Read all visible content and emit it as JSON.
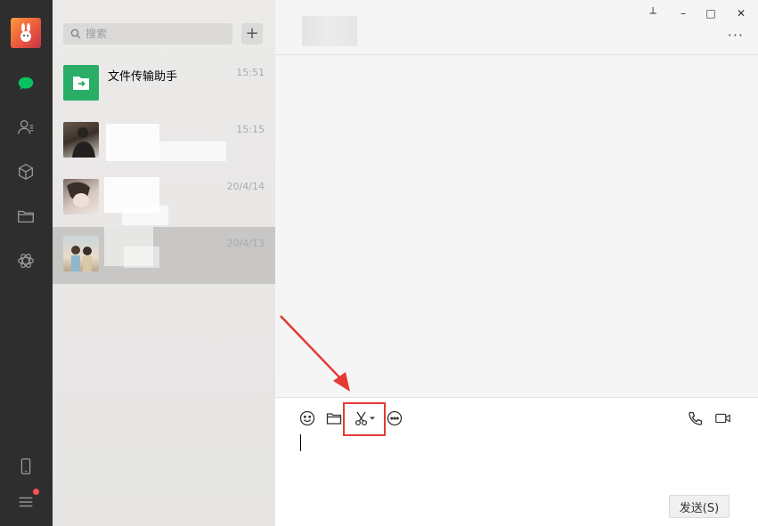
{
  "search": {
    "placeholder": "搜索"
  },
  "list": {
    "add_label": "+",
    "conversations": [
      {
        "name": "文件传输助手",
        "time": "15:51",
        "selected": false
      },
      {
        "name": "",
        "time": "15:15",
        "selected": false
      },
      {
        "name": "",
        "time": "20/4/14",
        "selected": false
      },
      {
        "name": "",
        "time": "20/4/13",
        "selected": true
      }
    ]
  },
  "window": {
    "pin_label": "┴",
    "minimize_label": "–",
    "maximize_label": "□",
    "close_label": "✕",
    "more_label": "···"
  },
  "composer": {
    "send_label": "发送(S)"
  },
  "colors": {
    "accent": "#07c160",
    "highlight": "#e53935",
    "rail": "#2e2e2e"
  },
  "icons": [
    "chat-icon",
    "contacts-icon",
    "box-icon",
    "folder-icon",
    "moments-icon",
    "phone-icon",
    "menu-icon",
    "emoji-icon",
    "file-icon",
    "scissors-icon",
    "chat-history-icon",
    "voice-call-icon",
    "video-call-icon"
  ]
}
